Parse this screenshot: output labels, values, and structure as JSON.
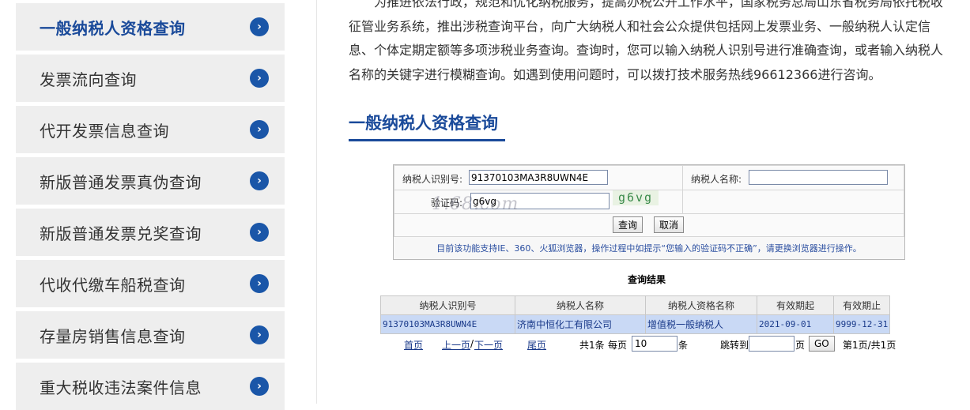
{
  "sidebar": {
    "items": [
      {
        "label": "一般纳税人资格查询",
        "active": true
      },
      {
        "label": "发票流向查询"
      },
      {
        "label": "代开发票信息查询"
      },
      {
        "label": "新版普通发票真伪查询"
      },
      {
        "label": "新版普通发票兑奖查询"
      },
      {
        "label": "代收代缴车船税查询"
      },
      {
        "label": "存量房销售信息查询"
      },
      {
        "label": "重大税收违法案件信息"
      }
    ],
    "arrow_glyph": "›"
  },
  "intro": {
    "text": "为推进依法行政，规范和优化纳税服务，提高办税公开工作水平，国家税务总局山东省税务局依托税收征管业务系统，推出涉税查询平台，向广大纳税人和社会公众提供包括网上发票业务、一般纳税人认定信息、个体定期定额等多项涉税业务查询。查询时，您可以输入纳税人识别号进行准确查询，或者输入纳税人名称的关键字进行模糊查询。如遇到使用问题时，可以拨打技术服务热线96612366进行咨询。"
  },
  "section": {
    "title": "一般纳税人资格查询"
  },
  "form": {
    "taxid_label": "纳税人识别号:",
    "taxid_value": "91370103MA3R8UWN4E",
    "name_label": "纳税人名称:",
    "name_value": "",
    "captcha_label": "验证码:",
    "captcha_value": "g6vg",
    "captcha_image_text": "g6vg",
    "watermark": "1.68.com",
    "query_button": "查询",
    "cancel_button": "取消",
    "notice": "目前该功能支持IE、360、火狐浏览器，操作过程中如提示“您输入的验证码不正确”，请更换浏览器进行操作。"
  },
  "results": {
    "title": "查询结果",
    "columns": [
      "纳税人识别号",
      "纳税人名称",
      "纳税人资格名称",
      "有效期起",
      "有效期止"
    ],
    "rows": [
      [
        "91370103MA3R8UWN4E",
        "济南中恒化工有限公司",
        "增值税一般纳税人",
        "2021-09-01",
        "9999-12-31"
      ]
    ]
  },
  "pager": {
    "first": "首页",
    "prev": "上一页",
    "sep": "/",
    "next": "下一页",
    "last": "尾页",
    "total": "共1条",
    "per_page_label": "每页",
    "per_page_value": "10",
    "per_page_unit": "条",
    "jump_label": "跳转到",
    "jump_value": "",
    "page_unit": "页",
    "go_button": "GO",
    "page_info": "第1页/共1页"
  },
  "colors": {
    "accent": "#1a4a9a",
    "arrow_bg": "#1a56a8",
    "row_highlight": "#c9d9f5"
  }
}
